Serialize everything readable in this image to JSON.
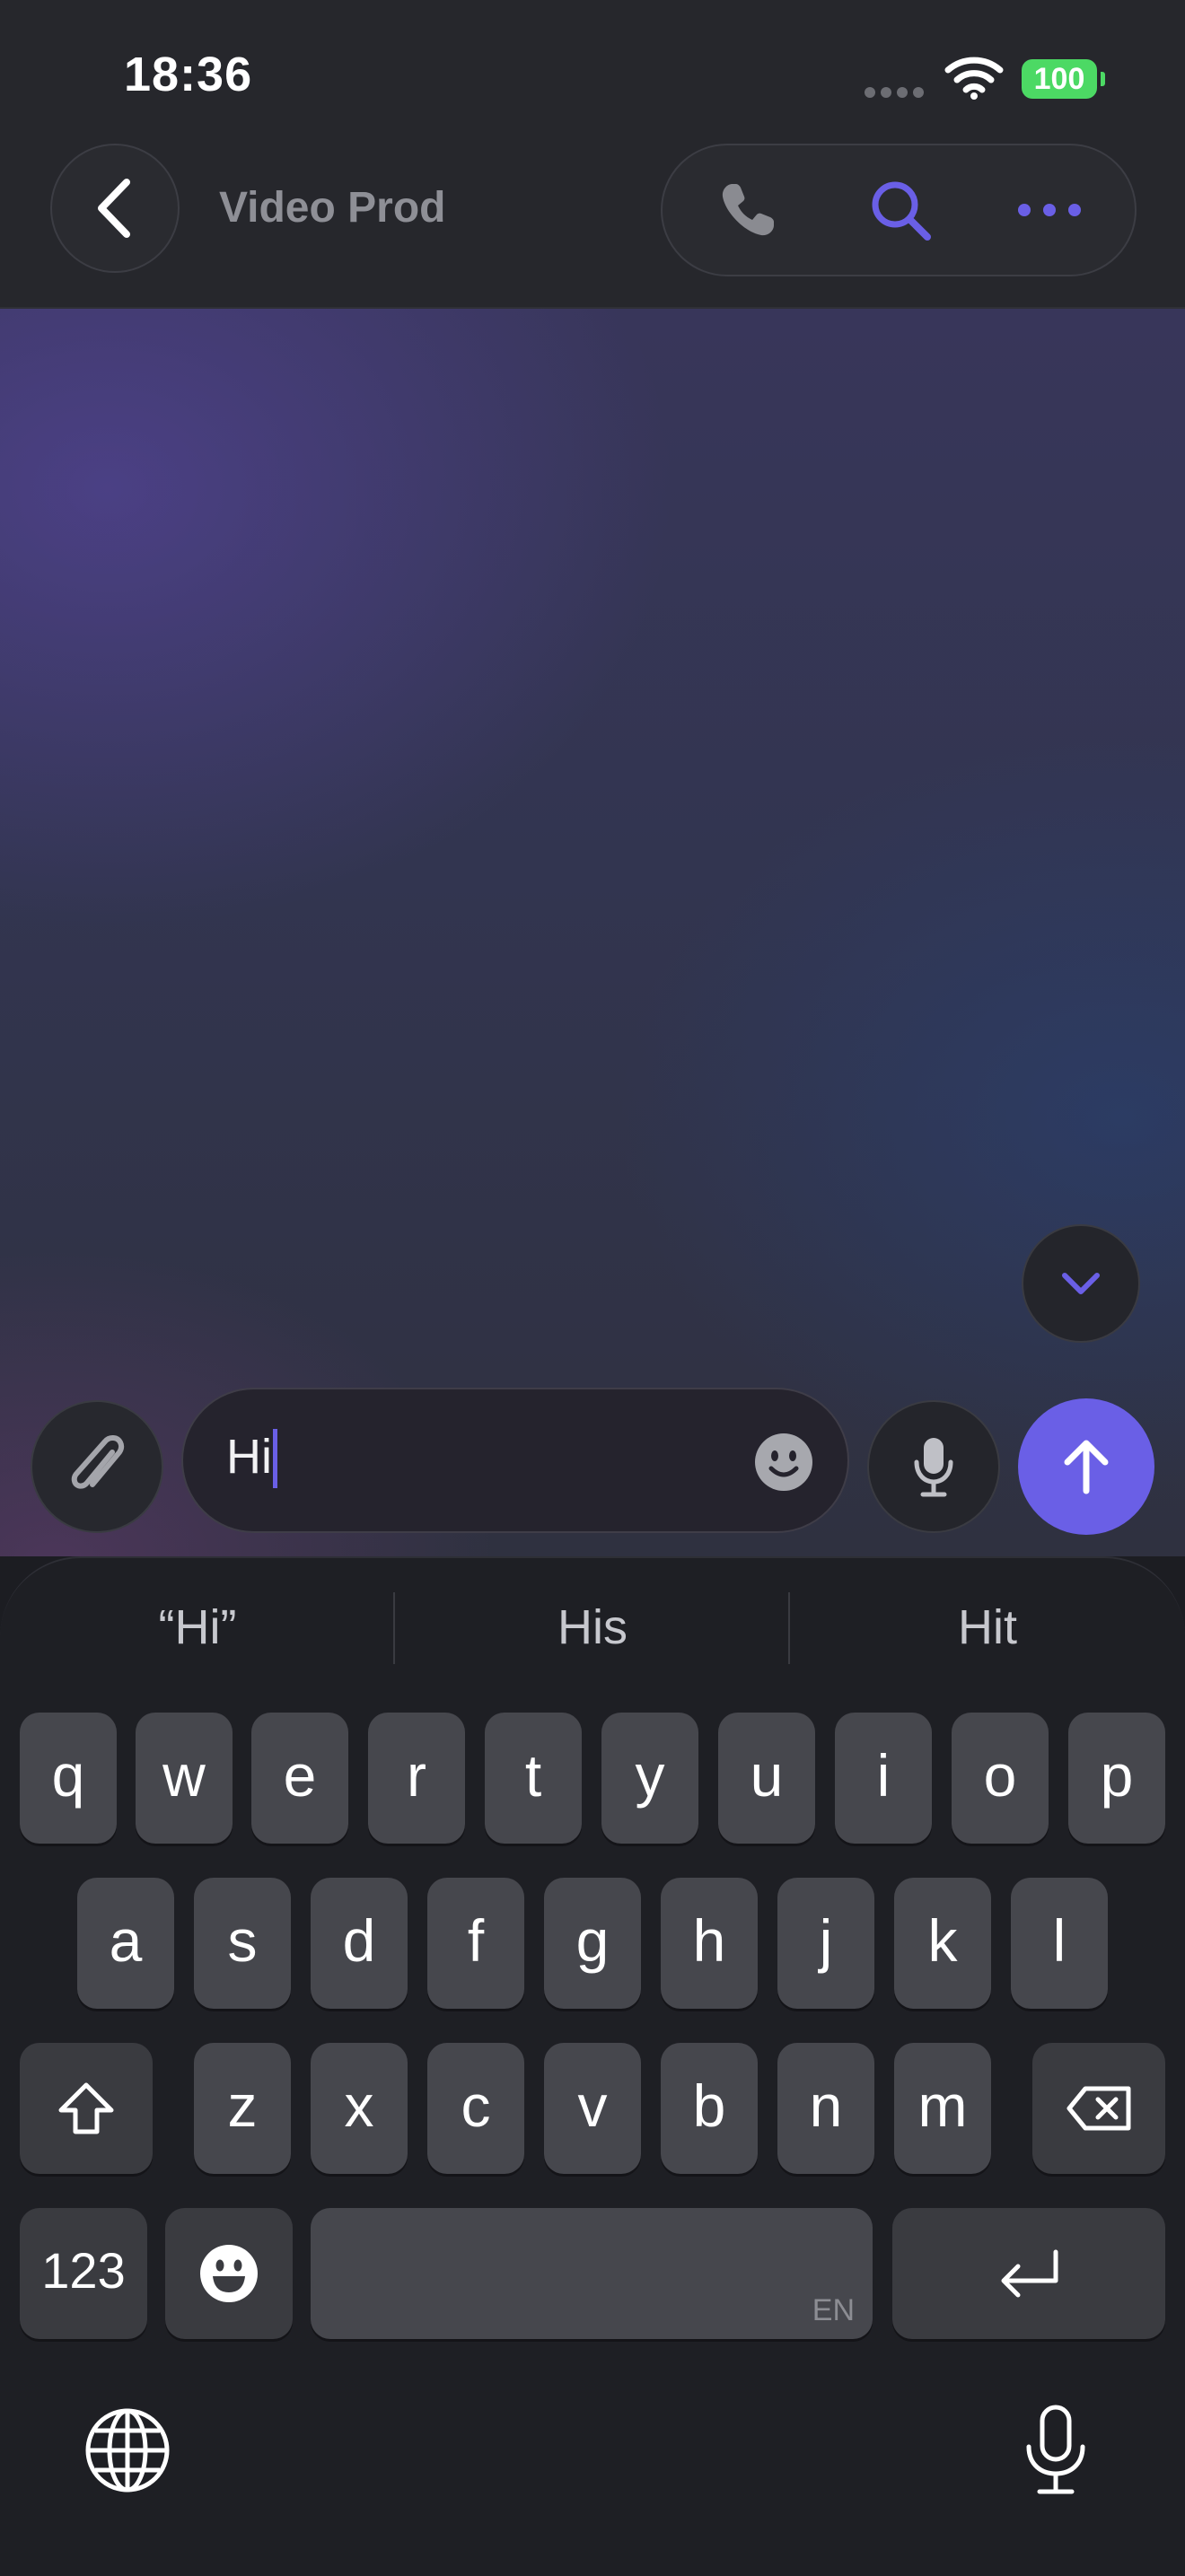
{
  "status_bar": {
    "time": "18:36",
    "battery": "100"
  },
  "header": {
    "title": "Video Prod"
  },
  "composer": {
    "text": "Hi"
  },
  "keyboard": {
    "suggestions": [
      "“Hi”",
      "His",
      "Hit"
    ],
    "row1": [
      "q",
      "w",
      "e",
      "r",
      "t",
      "y",
      "u",
      "i",
      "o",
      "p"
    ],
    "row2": [
      "a",
      "s",
      "d",
      "f",
      "g",
      "h",
      "j",
      "k",
      "l"
    ],
    "row3": [
      "z",
      "x",
      "c",
      "v",
      "b",
      "n",
      "m"
    ],
    "numbers_label": "123",
    "space_lang": "EN"
  },
  "colors": {
    "accent": "#6a5fe6",
    "battery": "#4cd964"
  },
  "icons": [
    "back-chevron-icon",
    "phone-icon",
    "search-icon",
    "more-icon",
    "chevron-down-icon",
    "paperclip-icon",
    "emoji-icon",
    "microphone-icon",
    "arrow-up-icon",
    "shift-icon",
    "backspace-icon",
    "return-icon",
    "globe-icon"
  ]
}
